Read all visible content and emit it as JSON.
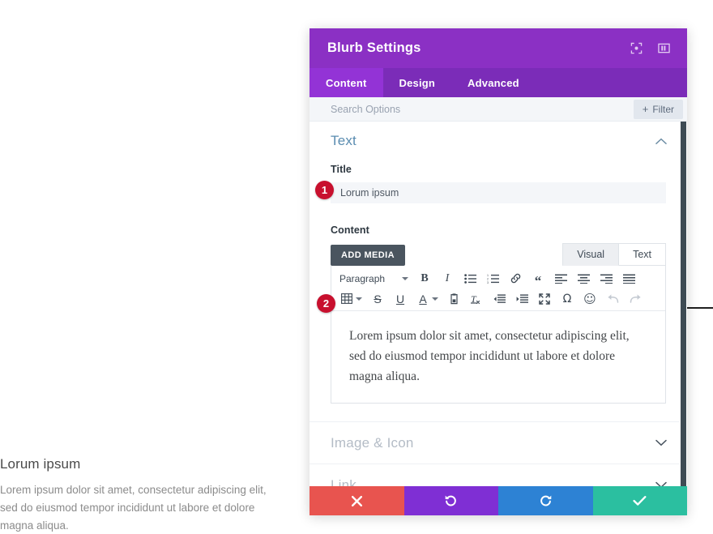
{
  "preview": {
    "title": "Lorum ipsum",
    "body": "Lorem ipsum dolor sit amet, consectetur adipiscing elit, sed do eiusmod tempor incididunt ut labore et dolore magna aliqua."
  },
  "modal": {
    "header": {
      "title": "Blurb Settings",
      "icons": [
        {
          "name": "fullscreen-target-icon",
          "label": "Expand Settings"
        },
        {
          "name": "panel-layout-icon",
          "label": "Change Modal Position"
        }
      ]
    },
    "tabs": [
      {
        "label": "Content",
        "active": true
      },
      {
        "label": "Design",
        "active": false
      },
      {
        "label": "Advanced",
        "active": false
      }
    ],
    "search": {
      "placeholder": "Search Options",
      "value": "",
      "filter_label": "Filter",
      "filter_plus": "+"
    },
    "sections": [
      {
        "name": "Text",
        "state": "open",
        "chevron": "chevron-up-icon",
        "fields": {
          "title_label": "Title",
          "title_value": "Lorum ipsum",
          "content_label": "Content",
          "add_media_label": "ADD MEDIA",
          "editor_tabs": [
            {
              "label": "Visual",
              "active": true
            },
            {
              "label": "Text",
              "active": false
            }
          ],
          "format_select": "Paragraph",
          "editor_text": "Lorem ipsum dolor sit amet, consectetur adipiscing elit, sed do eiusmod tempor incididunt ut labore et dolore magna aliqua.",
          "toolbar_row1": [
            {
              "name": "bold-icon",
              "glyph": "B",
              "dim": false
            },
            {
              "name": "italic-icon",
              "glyph": "I",
              "dim": false
            },
            {
              "name": "bulleted-list-icon",
              "glyph": "",
              "dim": false
            },
            {
              "name": "numbered-list-icon",
              "glyph": "",
              "dim": false
            },
            {
              "name": "link-icon",
              "glyph": "",
              "dim": false
            },
            {
              "name": "blockquote-icon",
              "glyph": "“",
              "dim": false
            },
            {
              "name": "align-left-icon",
              "glyph": "",
              "dim": false
            },
            {
              "name": "align-center-icon",
              "glyph": "",
              "dim": false
            },
            {
              "name": "align-right-icon",
              "glyph": "",
              "dim": false
            },
            {
              "name": "align-justify-icon",
              "glyph": "",
              "dim": false
            }
          ],
          "toolbar_row2": [
            {
              "name": "table-icon",
              "glyph": "",
              "dim": false
            },
            {
              "name": "strikethrough-icon",
              "glyph": "S",
              "dim": false
            },
            {
              "name": "underline-icon",
              "glyph": "U",
              "dim": false
            },
            {
              "name": "text-color-icon",
              "glyph": "A",
              "dim": false
            },
            {
              "name": "paste-as-text-icon",
              "glyph": "",
              "dim": false
            },
            {
              "name": "clear-formatting-icon",
              "glyph": "",
              "dim": false
            },
            {
              "name": "outdent-icon",
              "glyph": "",
              "dim": false
            },
            {
              "name": "indent-icon",
              "glyph": "",
              "dim": false
            },
            {
              "name": "fullscreen-icon",
              "glyph": "",
              "dim": false
            },
            {
              "name": "special-character-icon",
              "glyph": "Ω",
              "dim": false
            },
            {
              "name": "emoji-icon",
              "glyph": "☺",
              "dim": false
            },
            {
              "name": "undo-icon",
              "glyph": "",
              "dim": true
            },
            {
              "name": "redo-icon",
              "glyph": "",
              "dim": true
            }
          ]
        }
      },
      {
        "name": "Image & Icon",
        "state": "collapsed",
        "chevron": "chevron-down-icon"
      },
      {
        "name": "Link",
        "state": "collapsed",
        "chevron": "chevron-down-icon"
      }
    ],
    "footer": [
      {
        "name": "cancel-button",
        "icon": "close-x-icon",
        "color": "#E8544F"
      },
      {
        "name": "undo-button",
        "icon": "undo-arrow-icon",
        "color": "#7F2FD4"
      },
      {
        "name": "redo-button",
        "icon": "redo-arrow-icon",
        "color": "#2D82D4"
      },
      {
        "name": "save-button",
        "icon": "checkmark-icon",
        "color": "#2BBFA0"
      }
    ]
  },
  "annotations": [
    {
      "number": "1",
      "target": "title-input"
    },
    {
      "number": "2",
      "target": "content-editor"
    }
  ],
  "colors": {
    "header_purple": "#8B30C4",
    "tabbar_purple": "#7B2CB8",
    "tab_active_purple": "#9333D6",
    "section_heading_blue": "#5A8CB0",
    "badge_red": "#C8102E"
  }
}
